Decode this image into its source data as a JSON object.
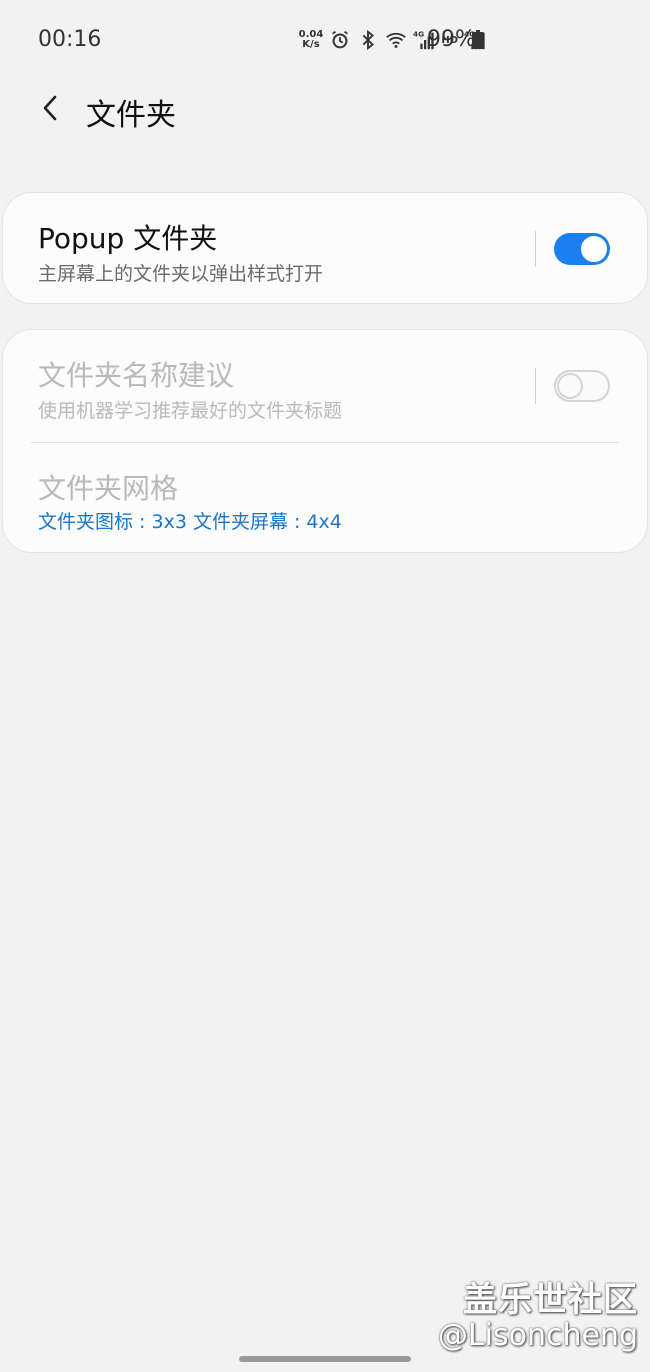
{
  "status_bar": {
    "time": "00:16",
    "net_speed_value": "0.04",
    "net_speed_unit": "K/s",
    "hd_label": "HD",
    "battery_percent": "99%"
  },
  "header": {
    "title": "文件夹"
  },
  "settings": {
    "popup_folder": {
      "title": "Popup 文件夹",
      "subtitle": "主屏幕上的文件夹以弹出样式打开",
      "enabled": true
    },
    "folder_name_suggestion": {
      "title": "文件夹名称建议",
      "subtitle": "使用机器学习推荐最好的文件夹标题",
      "enabled": false
    },
    "folder_grid": {
      "title": "文件夹网格",
      "subtitle": "文件夹图标 : 3x3 文件夹屏幕 : 4x4"
    }
  },
  "watermark": {
    "line1": "盖乐世社区",
    "line2": "@Lisoncheng"
  },
  "colors": {
    "accent": "#1a7ff0",
    "link": "#1976c9",
    "background": "#f2f2f2"
  }
}
